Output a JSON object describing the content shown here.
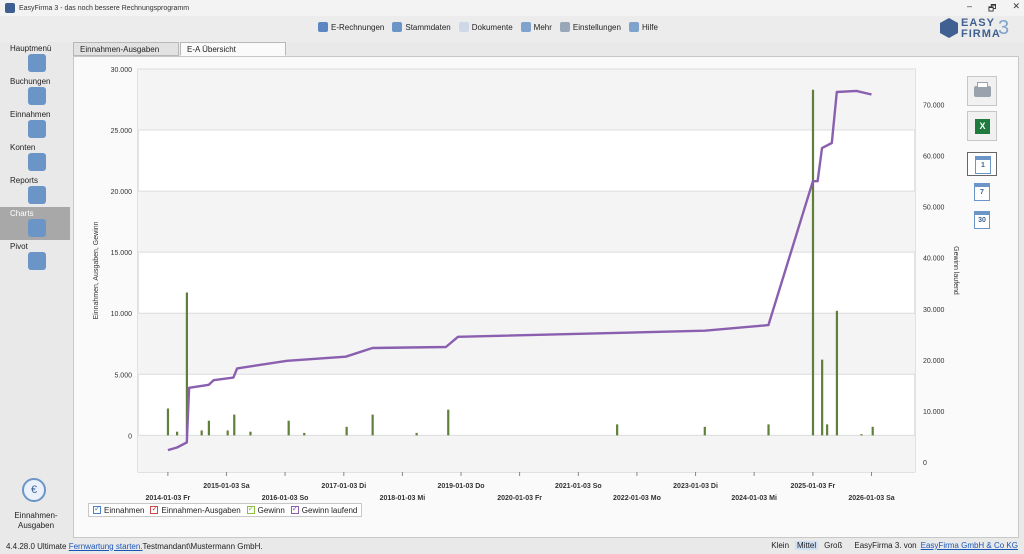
{
  "window": {
    "title": "EasyFirma 3 - das noch bessere Rechnungsprogramm",
    "minimize": "–",
    "maximize": "🗗",
    "close": "✕"
  },
  "logo": {
    "line1": "EASY",
    "line2": "FIRMA",
    "number": "3"
  },
  "menu": [
    {
      "label": "E-Rechnungen",
      "icon": "invoice-icon",
      "color": "#5b86bf"
    },
    {
      "label": "Stammdaten",
      "icon": "database-icon",
      "color": "#6c95c7"
    },
    {
      "label": "Dokumente",
      "icon": "document-icon",
      "color": "#cfd8e6"
    },
    {
      "label": "Mehr",
      "icon": "grid-icon",
      "color": "#7fa3cc"
    },
    {
      "label": "Einstellungen",
      "icon": "settings-icon",
      "color": "#9aa7b8"
    },
    {
      "label": "Hilfe",
      "icon": "help-icon",
      "color": "#7fa3cc"
    }
  ],
  "sidebar": {
    "items": [
      {
        "label": "Hauptmenü",
        "icon": "home-icon"
      },
      {
        "label": "Buchungen",
        "icon": "book-icon"
      },
      {
        "label": "Einnahmen",
        "icon": "coins-icon"
      },
      {
        "label": "Konten",
        "icon": "bank-icon"
      },
      {
        "label": "Reports",
        "icon": "report-icon"
      },
      {
        "label": "Charts",
        "icon": "chart-icon"
      },
      {
        "label": "Pivot",
        "icon": "pivot-icon"
      }
    ],
    "active": "Charts",
    "bottom": {
      "label": "Einnahmen-Ausgaben",
      "icon": "euro-icon",
      "symbol": "€"
    }
  },
  "tabs": [
    {
      "label": "Einnahmen-Ausgaben",
      "active": false
    },
    {
      "label": "E-A Übersicht",
      "active": true
    }
  ],
  "tools": {
    "print_icon": "printer-icon",
    "excel_icon": "excel-icon",
    "excel_letter": "X",
    "calendars": [
      "1",
      "7",
      "30"
    ],
    "selected_calendar": "1"
  },
  "legend": [
    {
      "label": "Einnahmen",
      "color": "#4a7fc0"
    },
    {
      "label": "Einnahmen-Ausgaben",
      "color": "#c84a4a"
    },
    {
      "label": "Gewinn",
      "color": "#8fbf3f"
    },
    {
      "label": "Gewinn laufend",
      "color": "#8a5fb0"
    }
  ],
  "chart_data": {
    "type": "bar",
    "ylabel": "Einnahmen, Ausgaben, Gewinn",
    "y2label": "Gewinn laufend",
    "ylim": [
      -3000,
      30000
    ],
    "y2lim": [
      -2000,
      77000
    ],
    "yticks": [
      0,
      5000,
      10000,
      15000,
      20000,
      25000,
      30000
    ],
    "ytick_labels": [
      "0",
      "5.000",
      "10.000",
      "15.000",
      "20.000",
      "25.000",
      "30.000"
    ],
    "y2ticks": [
      0,
      10000,
      20000,
      30000,
      40000,
      50000,
      60000,
      70000
    ],
    "y2tick_labels": [
      "0",
      "10.000",
      "20.000",
      "30.000",
      "40.000",
      "50.000",
      "60.000",
      "70.000"
    ],
    "xlim": [
      "2013-07-01",
      "2026-10-01"
    ],
    "xtick_labels": [
      {
        "date": "2014-01-03",
        "label": "2014-01-03 Fr",
        "row": 2
      },
      {
        "date": "2015-01-03",
        "label": "2015-01-03 Sa",
        "row": 1
      },
      {
        "date": "2016-01-03",
        "label": "2016-01-03 So",
        "row": 2
      },
      {
        "date": "2017-01-03",
        "label": "2017-01-03 Di",
        "row": 1
      },
      {
        "date": "2018-01-03",
        "label": "2018-01-03 Mi",
        "row": 2
      },
      {
        "date": "2019-01-03",
        "label": "2019-01-03 Do",
        "row": 1
      },
      {
        "date": "2020-01-03",
        "label": "2020-01-03 Fr",
        "row": 2
      },
      {
        "date": "2021-01-03",
        "label": "2021-01-03 So",
        "row": 1
      },
      {
        "date": "2022-01-03",
        "label": "2022-01-03 Mo",
        "row": 2
      },
      {
        "date": "2023-01-03",
        "label": "2023-01-03 Di",
        "row": 1
      },
      {
        "date": "2024-01-03",
        "label": "2024-01-03 Mi",
        "row": 2
      },
      {
        "date": "2025-01-03",
        "label": "2025-01-03 Fr",
        "row": 1
      },
      {
        "date": "2026-01-03",
        "label": "2026-01-03 Sa",
        "row": 2
      }
    ],
    "bars": [
      {
        "date": "2014-01-03",
        "value": 2200
      },
      {
        "date": "2014-03-01",
        "value": 300
      },
      {
        "date": "2014-05-01",
        "value": 11700
      },
      {
        "date": "2014-08-01",
        "value": 400
      },
      {
        "date": "2014-09-15",
        "value": 1200
      },
      {
        "date": "2015-01-10",
        "value": 400
      },
      {
        "date": "2015-02-20",
        "value": 1700
      },
      {
        "date": "2015-06-01",
        "value": 300
      },
      {
        "date": "2016-01-25",
        "value": 1200
      },
      {
        "date": "2016-05-01",
        "value": 200
      },
      {
        "date": "2017-01-20",
        "value": 700
      },
      {
        "date": "2017-07-01",
        "value": 1700
      },
      {
        "date": "2018-04-01",
        "value": 200
      },
      {
        "date": "2018-10-15",
        "value": 2100
      },
      {
        "date": "2021-09-01",
        "value": 900
      },
      {
        "date": "2023-03-01",
        "value": 700
      },
      {
        "date": "2024-04-01",
        "value": 900
      },
      {
        "date": "2025-01-03",
        "value": 28300
      },
      {
        "date": "2025-03-01",
        "value": 6200
      },
      {
        "date": "2025-04-01",
        "value": 900
      },
      {
        "date": "2025-06-01",
        "value": 10200
      },
      {
        "date": "2025-11-01",
        "value": 100
      },
      {
        "date": "2026-01-10",
        "value": 700
      }
    ],
    "line": [
      {
        "date": "2014-01-03",
        "value": 2300
      },
      {
        "date": "2014-03-01",
        "value": 2800
      },
      {
        "date": "2014-05-01",
        "value": 3800
      },
      {
        "date": "2014-05-15",
        "value": 14500
      },
      {
        "date": "2014-09-15",
        "value": 15100
      },
      {
        "date": "2014-10-15",
        "value": 16000
      },
      {
        "date": "2015-02-15",
        "value": 16500
      },
      {
        "date": "2015-03-10",
        "value": 18300
      },
      {
        "date": "2016-01-15",
        "value": 19800
      },
      {
        "date": "2017-01-15",
        "value": 20600
      },
      {
        "date": "2017-07-01",
        "value": 22300
      },
      {
        "date": "2018-10-01",
        "value": 22500
      },
      {
        "date": "2018-12-15",
        "value": 24500
      },
      {
        "date": "2023-03-01",
        "value": 25700
      },
      {
        "date": "2024-04-01",
        "value": 26800
      },
      {
        "date": "2025-01-03",
        "value": 55000
      },
      {
        "date": "2025-02-01",
        "value": 55000
      },
      {
        "date": "2025-03-01",
        "value": 61500
      },
      {
        "date": "2025-05-01",
        "value": 62500
      },
      {
        "date": "2025-06-01",
        "value": 72500
      },
      {
        "date": "2025-10-01",
        "value": 72700
      },
      {
        "date": "2026-01-03",
        "value": 72000
      }
    ],
    "bar_color": "#5f7f3a",
    "line_color": "#8a5fb0"
  },
  "status": {
    "version": "4.4.28.0 Ultimate",
    "remote_link": "Fernwartung starten.",
    "tenant": "Testmandant\\Mustermann GmbH.",
    "size_small": "Klein",
    "size_medium": "Mittel",
    "size_large": "Groß",
    "size_selected": "Mittel",
    "by": "EasyFirma 3. von",
    "company_link": "EasyFirma GmbH & Co KG"
  }
}
